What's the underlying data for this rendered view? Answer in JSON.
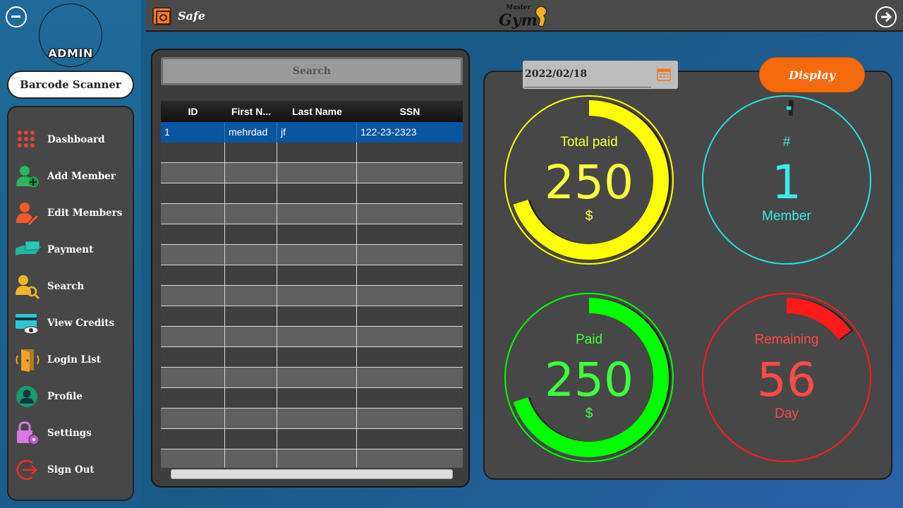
{
  "sidebar": {
    "admin_label": "ADMIN",
    "barcode_button": "Barcode Scanner",
    "menu": [
      {
        "label": "Dashboard",
        "icon": "dashboard-grid-icon"
      },
      {
        "label": "Add Member",
        "icon": "add-user-icon"
      },
      {
        "label": "Edit Members",
        "icon": "edit-user-icon"
      },
      {
        "label": "Payment",
        "icon": "payment-hand-icon"
      },
      {
        "label": "Search",
        "icon": "search-user-icon"
      },
      {
        "label": "View Credits",
        "icon": "credit-card-eye-icon"
      },
      {
        "label": "Login List",
        "icon": "door-icon"
      },
      {
        "label": "Profile",
        "icon": "profile-icon"
      },
      {
        "label": "Settings",
        "icon": "settings-lock-icon"
      },
      {
        "label": "Sign Out",
        "icon": "sign-out-icon"
      }
    ]
  },
  "topbar": {
    "title": "Safe",
    "logo_top": "Master",
    "logo_main": "Gym"
  },
  "table": {
    "search_button": "Search",
    "columns": [
      "ID",
      "First N...",
      "Last Name",
      "SSN"
    ],
    "rows": [
      [
        "1",
        "mehrdad",
        "jf",
        "122-23-2323"
      ]
    ]
  },
  "controls": {
    "date": "2022/02/18",
    "display_button": "Display"
  },
  "gauges": {
    "total_paid": {
      "label": "Total paid",
      "value": "250",
      "unit": "$",
      "color": "#ffff00",
      "fraction": 0.7
    },
    "members": {
      "label": "#",
      "value": "1",
      "unit": "Member",
      "color": "#28e0e0",
      "fraction": 0.01
    },
    "paid": {
      "label": "Paid",
      "value": "250",
      "unit": "$",
      "color": "#00ff00",
      "fraction": 0.7
    },
    "remaining": {
      "label": "Remaining",
      "value": "56",
      "unit": "Day",
      "color": "#ff1a1a",
      "fraction": 0.15
    }
  },
  "colors": {
    "accent_orange": "#f56a0c",
    "selected_row": "#0a55a0",
    "panel": "#474747"
  }
}
